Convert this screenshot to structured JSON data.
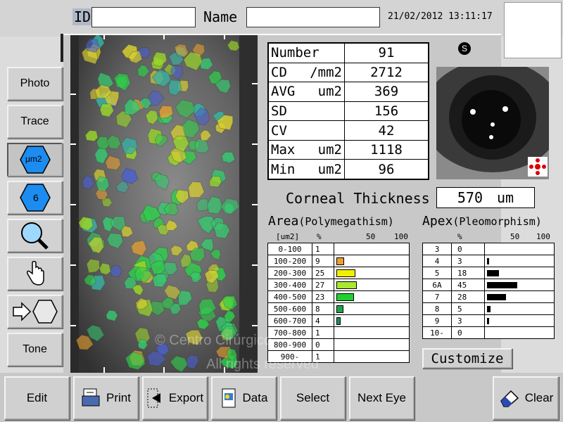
{
  "header": {
    "id_label": "ID",
    "id_value": "",
    "name_label": "Name",
    "name_value": "",
    "datetime": "21/02/2012 13:11:17"
  },
  "sidebar": {
    "photo": "Photo",
    "trace": "Trace",
    "um2": "μm2",
    "hex6": "6",
    "tone": "Tone"
  },
  "stats": [
    {
      "name": "Number",
      "unit": "",
      "value": "91"
    },
    {
      "name": "CD",
      "unit": "/mm2",
      "value": "2712"
    },
    {
      "name": "AVG",
      "unit": "um2",
      "value": "369"
    },
    {
      "name": "SD",
      "unit": "",
      "value": "156"
    },
    {
      "name": "CV",
      "unit": "",
      "value": "42"
    },
    {
      "name": "Max",
      "unit": "um2",
      "value": "1118"
    },
    {
      "name": "Min",
      "unit": "um2",
      "value": "96"
    }
  ],
  "tab_icon": "S",
  "corneal": {
    "label": "Corneal Thickness",
    "value": "570",
    "unit": "um"
  },
  "area": {
    "title": "Area",
    "subtitle": "(Polymegathism)",
    "unit_header": "[um2]",
    "pct_header": "%",
    "scale_50": "50",
    "scale_100": "100",
    "rows": [
      {
        "range": "0-100",
        "pct": "1",
        "value": 1,
        "color": "#ffffff"
      },
      {
        "range": "100-200",
        "pct": "9",
        "value": 9,
        "color": "#e8a030"
      },
      {
        "range": "200-300",
        "pct": "25",
        "value": 25,
        "color": "#f0f000"
      },
      {
        "range": "300-400",
        "pct": "27",
        "value": 27,
        "color": "#a8e830"
      },
      {
        "range": "400-500",
        "pct": "23",
        "value": 23,
        "color": "#20d030"
      },
      {
        "range": "500-600",
        "pct": "8",
        "value": 8,
        "color": "#20a050"
      },
      {
        "range": "600-700",
        "pct": "4",
        "value": 4,
        "color": "#209060"
      },
      {
        "range": "700-800",
        "pct": "1",
        "value": 1,
        "color": "#ffffff"
      },
      {
        "range": "800-900",
        "pct": "0",
        "value": 0,
        "color": "#ffffff"
      },
      {
        "range": "900-",
        "pct": "1",
        "value": 1,
        "color": "#ffffff"
      }
    ]
  },
  "apex": {
    "title": "Apex",
    "subtitle": "(Pleomorphism)",
    "pct_header": "%",
    "scale_50": "50",
    "scale_100": "100",
    "rows": [
      {
        "apex": "3",
        "pct": "0",
        "value": 0
      },
      {
        "apex": "4",
        "pct": "3",
        "value": 3
      },
      {
        "apex": "5",
        "pct": "18",
        "value": 18
      },
      {
        "apex": "6A",
        "pct": "45",
        "value": 45
      },
      {
        "apex": "7",
        "pct": "28",
        "value": 28
      },
      {
        "apex": "8",
        "pct": "5",
        "value": 5
      },
      {
        "apex": "9",
        "pct": "3",
        "value": 3
      },
      {
        "apex": "10-",
        "pct": "0",
        "value": 0
      }
    ]
  },
  "customize": "Customize",
  "watermark": {
    "line1": "© Centro Cirúrgico",
    "line2": "All rights reserved"
  },
  "bottom": {
    "edit": "Edit",
    "print": "Print",
    "export": "Export",
    "data": "Data",
    "select": "Select",
    "next_eye": "Next Eye",
    "clear": "Clear"
  }
}
